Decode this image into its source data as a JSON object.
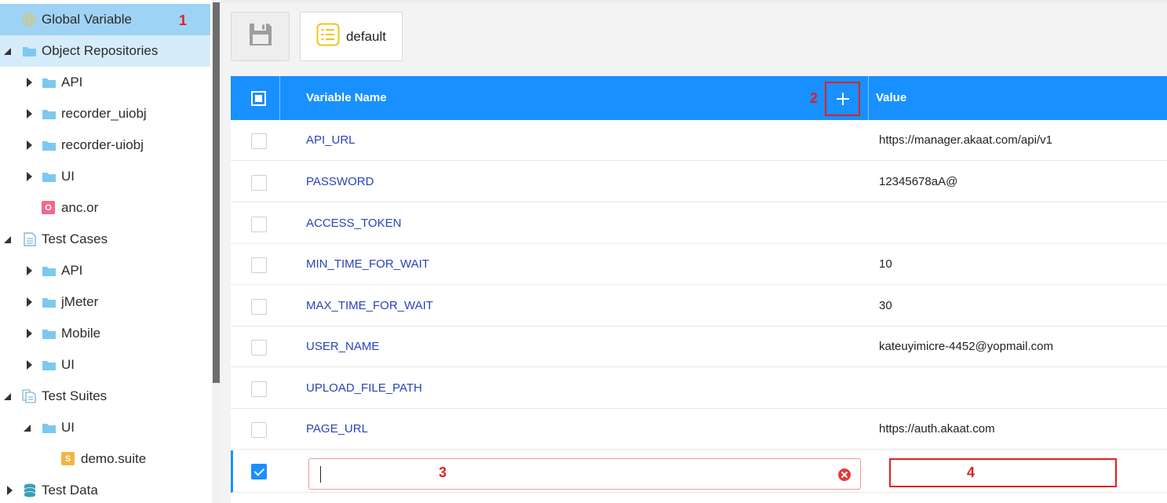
{
  "sidebar": {
    "items": [
      {
        "label": "Global Variable",
        "icon": "globe-icon",
        "annotation": "1"
      },
      {
        "label": "Object Repositories",
        "icon": "folder-icon"
      },
      {
        "label": "API",
        "icon": "folder-icon"
      },
      {
        "label": "recorder_uiobj",
        "icon": "folder-icon"
      },
      {
        "label": "recorder-uiobj",
        "icon": "folder-icon"
      },
      {
        "label": "UI",
        "icon": "folder-icon"
      },
      {
        "label": "anc.or",
        "icon": "object-repo-file-icon",
        "icon_text": "O"
      },
      {
        "label": "Test Cases",
        "icon": "document-icon"
      },
      {
        "label": "API",
        "icon": "folder-icon"
      },
      {
        "label": "jMeter",
        "icon": "folder-icon"
      },
      {
        "label": "Mobile",
        "icon": "folder-icon"
      },
      {
        "label": "UI",
        "icon": "folder-icon"
      },
      {
        "label": "Test Suites",
        "icon": "documents-icon"
      },
      {
        "label": "UI",
        "icon": "folder-icon"
      },
      {
        "label": "demo.suite",
        "icon": "suite-file-icon",
        "icon_text": "S"
      },
      {
        "label": "Test Data",
        "icon": "database-icon"
      }
    ]
  },
  "toolbar": {
    "save_icon": "floppy-disk-icon",
    "profile_label": "default",
    "profile_icon": "list-icon"
  },
  "table": {
    "columns": {
      "name": "Variable Name",
      "value": "Value"
    },
    "add_annotation": "2",
    "rows": [
      {
        "name": "API_URL",
        "value": "https://manager.akaat.com/api/v1"
      },
      {
        "name": "PASSWORD",
        "value": "12345678aA@"
      },
      {
        "name": "ACCESS_TOKEN",
        "value": ""
      },
      {
        "name": "MIN_TIME_FOR_WAIT",
        "value": "10"
      },
      {
        "name": "MAX_TIME_FOR_WAIT",
        "value": "30"
      },
      {
        "name": "USER_NAME",
        "value": "kateuyimicre-4452@yopmail.com"
      },
      {
        "name": "UPLOAD_FILE_PATH",
        "value": ""
      },
      {
        "name": "PAGE_URL",
        "value": "https://auth.akaat.com"
      }
    ],
    "new_row": {
      "name_value": "",
      "name_annotation": "3",
      "value_annotation": "4",
      "checked": true
    }
  },
  "colors": {
    "header": "#1890ff",
    "selected_tree": "#9fd3f5",
    "annotation": "#e02020",
    "variable_link": "#2744b8"
  }
}
